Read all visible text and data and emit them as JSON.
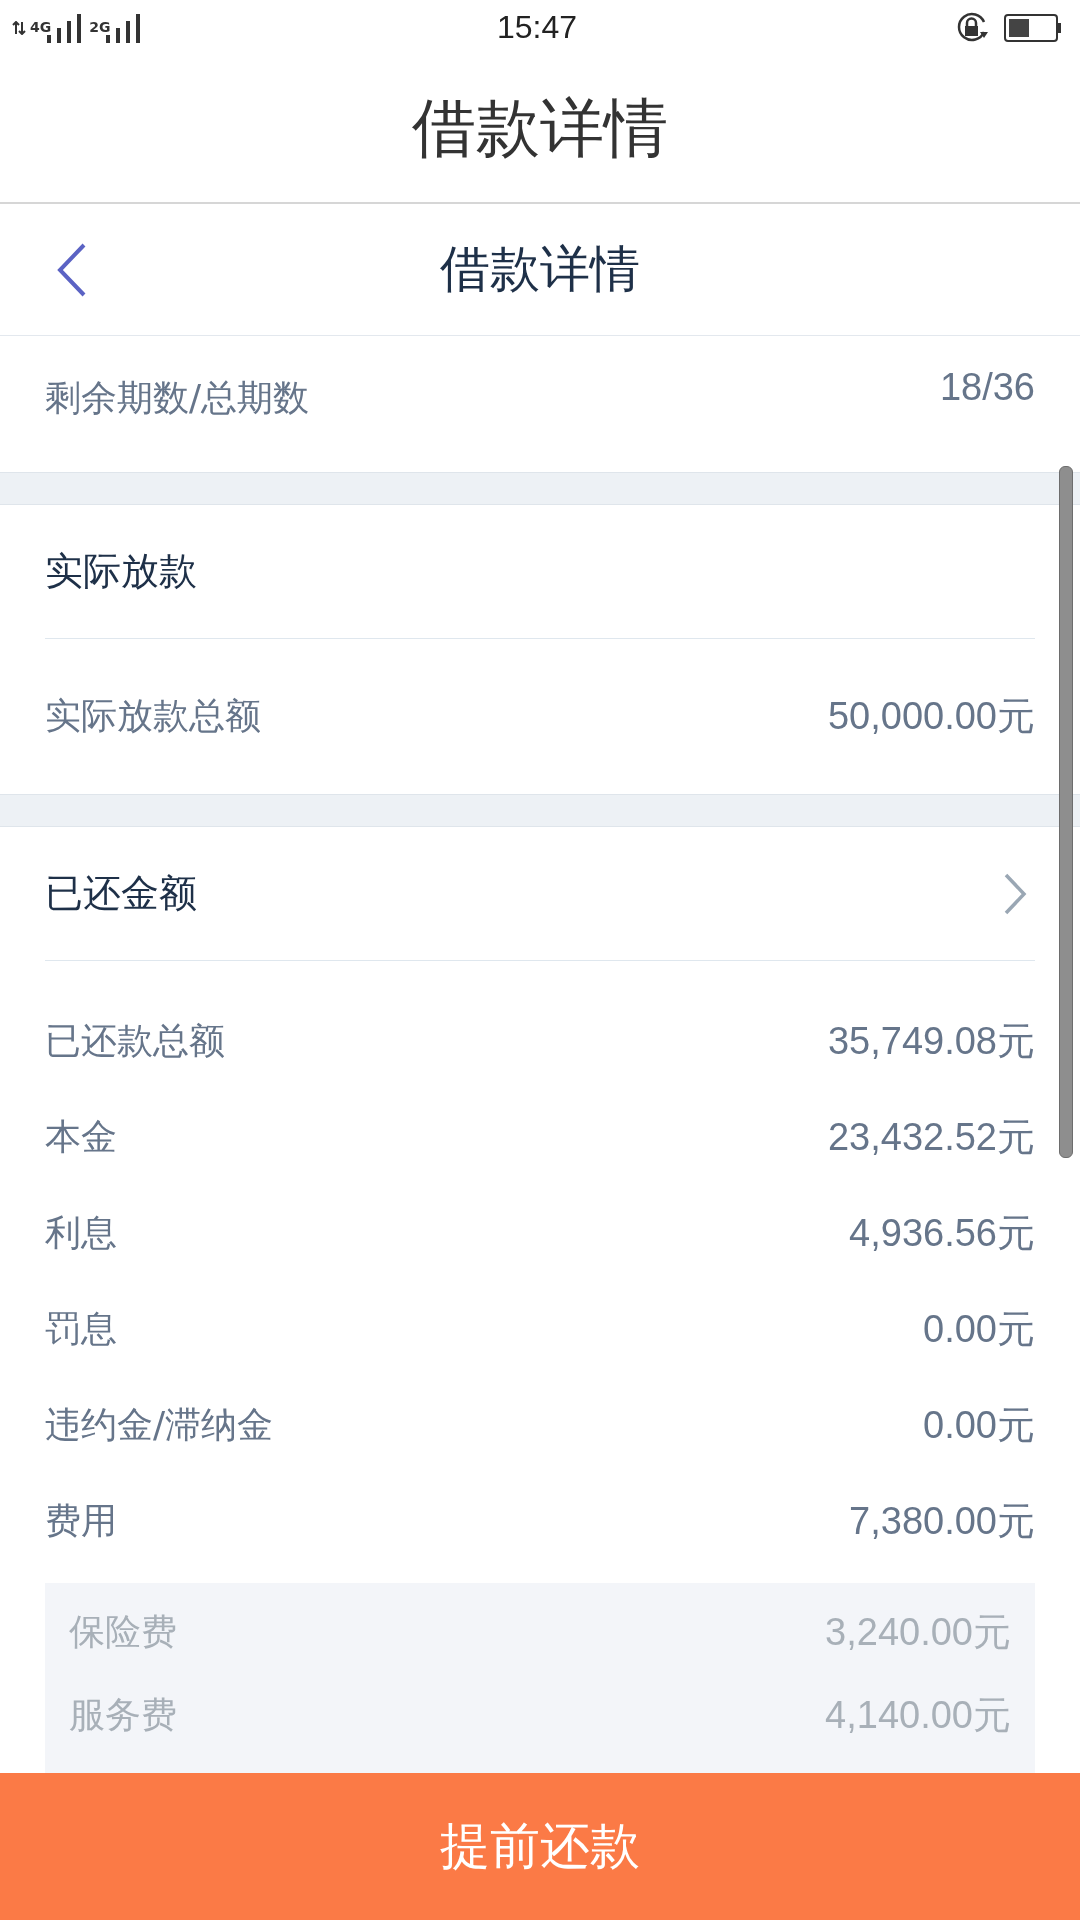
{
  "status_bar": {
    "network_1": "4G",
    "network_2": "2G",
    "time": "15:47"
  },
  "app_title": "借款详情",
  "nav": {
    "title": "借款详情"
  },
  "term": {
    "label": "剩余期数/总期数",
    "value": "18/36"
  },
  "sections": [
    {
      "title": "实际放款",
      "has_arrow": false,
      "rows": [
        {
          "label": "实际放款总额",
          "value": "50,000.00元"
        }
      ]
    },
    {
      "title": "已还金额",
      "has_arrow": true,
      "rows": [
        {
          "label": "已还款总额",
          "value": "35,749.08元"
        },
        {
          "label": "本金",
          "value": "23,432.52元"
        },
        {
          "label": "利息",
          "value": "4,936.56元"
        },
        {
          "label": "罚息",
          "value": "0.00元"
        },
        {
          "label": "违约金/滞纳金",
          "value": "0.00元"
        },
        {
          "label": "费用",
          "value": "7,380.00元"
        }
      ],
      "sub_rows": [
        {
          "label": "保险费",
          "value": "3,240.00元"
        },
        {
          "label": "服务费",
          "value": "4,140.00元"
        }
      ]
    }
  ],
  "button": "提前还款"
}
